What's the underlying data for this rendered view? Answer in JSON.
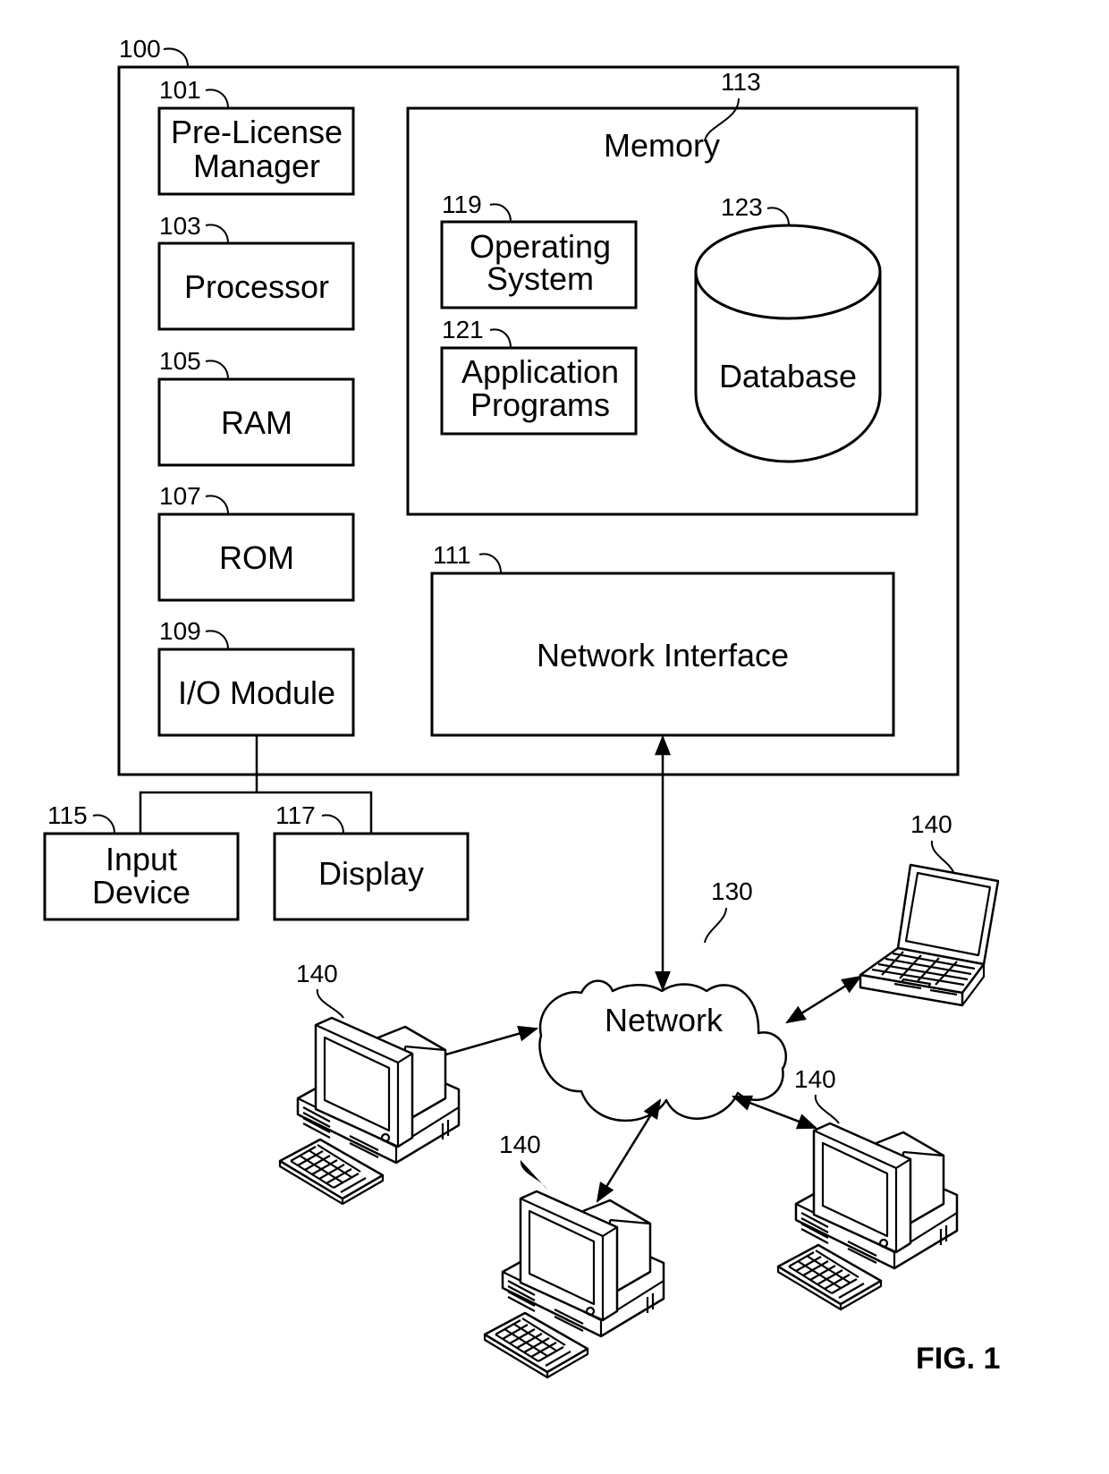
{
  "figure_label": "FIG. 1",
  "system": {
    "ref": "100",
    "components": [
      {
        "ref": "101",
        "lines": [
          "Pre-License",
          "Manager"
        ]
      },
      {
        "ref": "103",
        "lines": [
          "Processor"
        ]
      },
      {
        "ref": "105",
        "lines": [
          "RAM"
        ]
      },
      {
        "ref": "107",
        "lines": [
          "ROM"
        ]
      },
      {
        "ref": "109",
        "lines": [
          "I/O Module"
        ]
      }
    ],
    "memory": {
      "ref": "113",
      "label": "Memory",
      "operating_system": {
        "ref": "119",
        "lines": [
          "Operating",
          "System"
        ]
      },
      "application_programs": {
        "ref": "121",
        "lines": [
          "Application",
          "Programs"
        ]
      },
      "database": {
        "ref": "123",
        "label": "Database"
      }
    },
    "network_interface": {
      "ref": "111",
      "label": "Network Interface"
    }
  },
  "peripherals": [
    {
      "ref": "115",
      "lines": [
        "Input",
        "Device"
      ]
    },
    {
      "ref": "117",
      "lines": [
        "Display"
      ]
    }
  ],
  "network": {
    "ref": "130",
    "label": "Network"
  },
  "terminals": [
    {
      "ref": "140",
      "type": "laptop"
    },
    {
      "ref": "140",
      "type": "desktop"
    },
    {
      "ref": "140",
      "type": "desktop"
    },
    {
      "ref": "140",
      "type": "desktop"
    }
  ]
}
